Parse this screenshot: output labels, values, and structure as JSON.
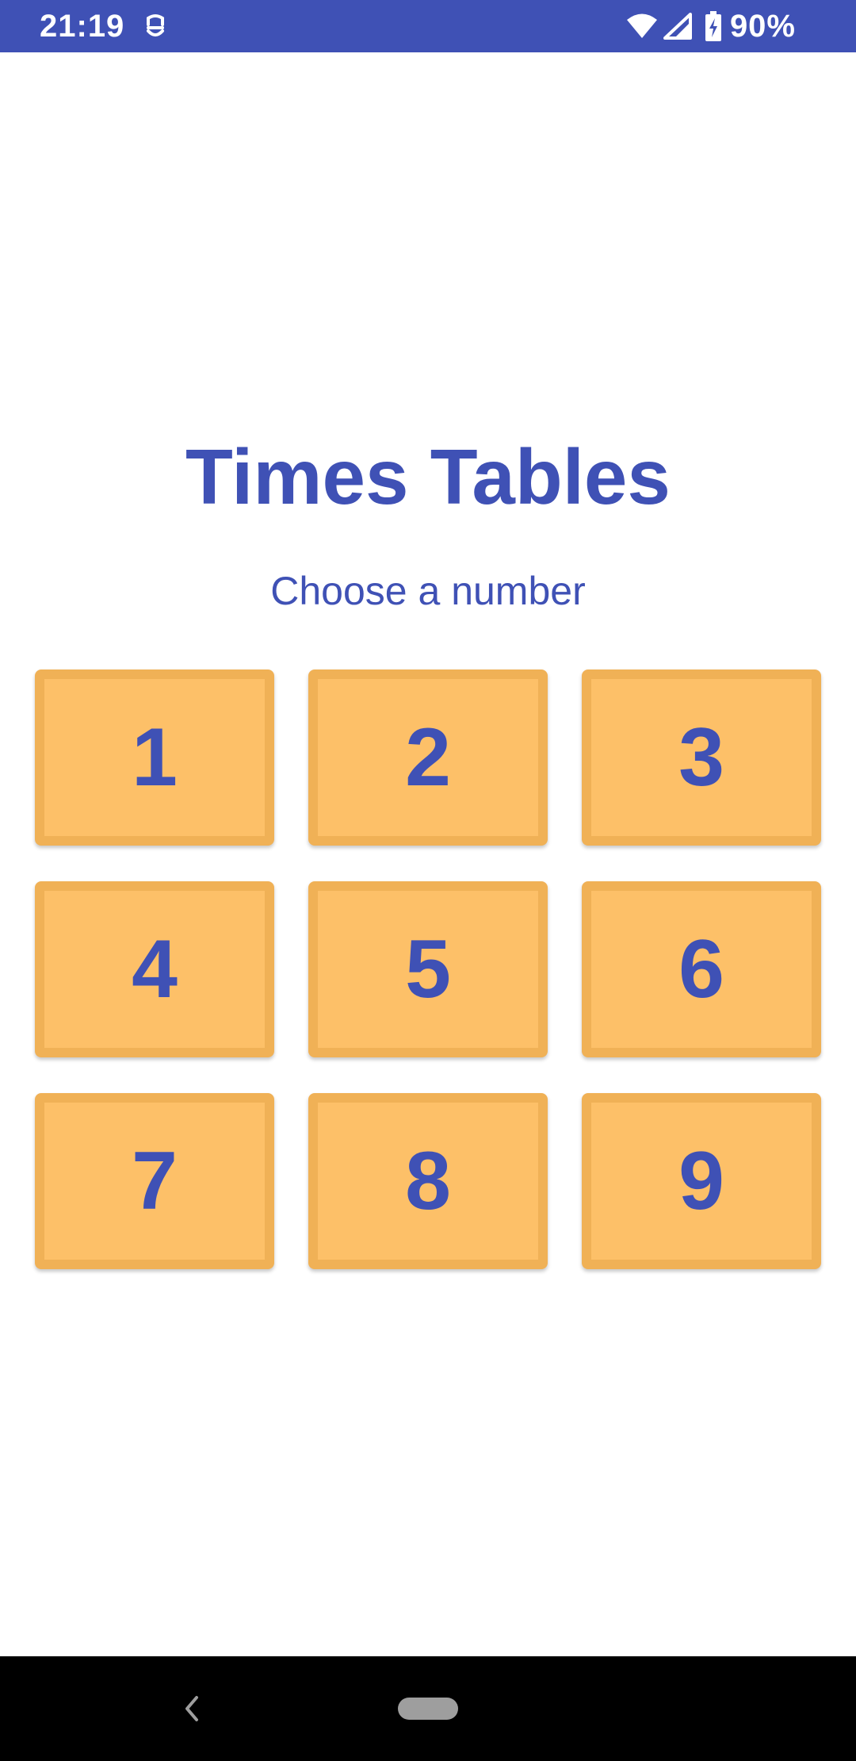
{
  "status_bar": {
    "time": "21:19",
    "battery": "90%",
    "background_color": "#3f51b5",
    "icons": [
      "app-notification-icon",
      "wifi-icon",
      "signal-icon",
      "battery-charging-icon"
    ]
  },
  "main": {
    "title": "Times Tables",
    "subtitle": "Choose a number",
    "buttons": [
      "1",
      "2",
      "3",
      "4",
      "5",
      "6",
      "7",
      "8",
      "9"
    ],
    "accent_color": "#3f51b5",
    "button_color": "#fdc068",
    "button_border_color": "#f0b156"
  },
  "nav_bar": {
    "icons": [
      "back-icon",
      "home-pill-icon"
    ]
  }
}
